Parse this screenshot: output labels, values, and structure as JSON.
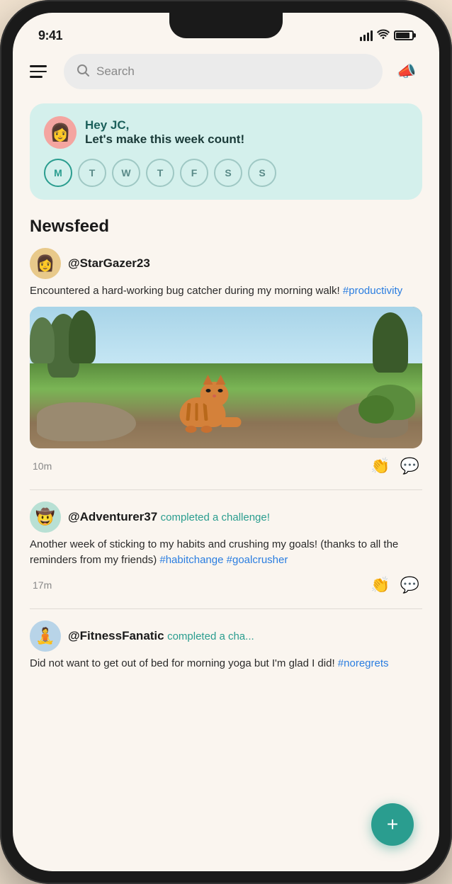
{
  "statusBar": {
    "time": "9:41"
  },
  "toolbar": {
    "searchPlaceholder": "Search",
    "menuLabel": "menu"
  },
  "banner": {
    "greeting": "Hey JC,",
    "subtitle": "Let's make this week count!",
    "avatar": "👩",
    "days": [
      {
        "label": "M",
        "active": true
      },
      {
        "label": "T",
        "active": false
      },
      {
        "label": "W",
        "active": false
      },
      {
        "label": "T",
        "active": false
      },
      {
        "label": "F",
        "active": false
      },
      {
        "label": "S",
        "active": false
      },
      {
        "label": "S",
        "active": false
      }
    ]
  },
  "newsfeed": {
    "title": "Newsfeed",
    "posts": [
      {
        "id": 1,
        "username": "@StarGazer23",
        "action": "",
        "text": "Encountered a hard-working bug catcher during my morning walk!",
        "hashtags": "#productivity",
        "hasImage": true,
        "time": "10m",
        "avatar": "👩"
      },
      {
        "id": 2,
        "username": "@Adventurer37",
        "action": "completed a challenge!",
        "text": "Another week of sticking to my habits and crushing my goals! (thanks to all the reminders from my friends)",
        "hashtags": "#habitchange #goalcrusher",
        "hasImage": false,
        "time": "17m",
        "avatar": "🤠"
      },
      {
        "id": 3,
        "username": "@FitnessFanatic",
        "action": "completed a cha...",
        "text": "Did not want to get out of bed for morning yoga but I'm glad I did!",
        "hashtags": "#noregrets",
        "hasImage": false,
        "time": "",
        "avatar": "🧘"
      }
    ]
  },
  "fab": {
    "label": "+"
  }
}
